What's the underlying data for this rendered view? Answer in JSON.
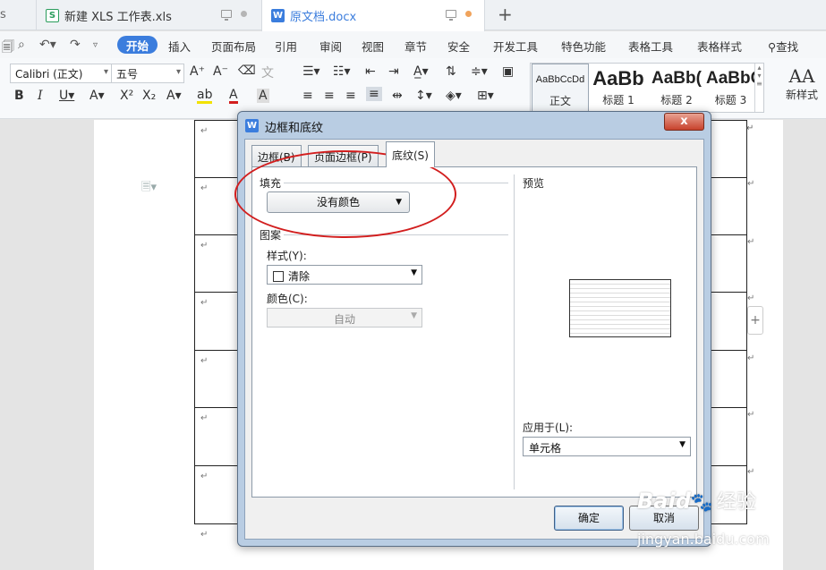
{
  "tabs": [
    {
      "label": "新建 XLS 工作表.xls",
      "icon": "S"
    },
    {
      "label": "原文档.docx",
      "icon": "W"
    }
  ],
  "new_tab_label": "+",
  "menu": {
    "start": "开始",
    "items": [
      "插入",
      "页面布局",
      "引用",
      "审阅",
      "视图",
      "章节",
      "安全",
      "开发工具",
      "特色功能",
      "表格工具",
      "表格样式"
    ],
    "search": "查找"
  },
  "ribbon": {
    "font_name": "Calibri (正文)",
    "font_size": "五号",
    "styles": [
      {
        "sample": "AaBbCcDd",
        "name": "正文"
      },
      {
        "sample": "AaBb",
        "name": "标题 1"
      },
      {
        "sample": "AaBb(",
        "name": "标题 2"
      },
      {
        "sample": "AaBbC(",
        "name": "标题 3"
      }
    ],
    "new_style_glyph": "AA",
    "new_style": "新样式"
  },
  "dialog": {
    "title": "边框和底纹",
    "close": "x",
    "tabs": [
      "边框(B)",
      "页面边框(P)",
      "底纹(S)"
    ],
    "fill_label": "填充",
    "fill_value": "没有颜色",
    "pattern_label": "图案",
    "style_label": "样式(Y):",
    "style_value": "清除",
    "color_label": "颜色(C):",
    "color_value": "自动",
    "preview_label": "预览",
    "apply_label": "应用于(L):",
    "apply_value": "单元格",
    "ok": "确定",
    "cancel": "取消"
  },
  "watermark": {
    "logo": "Baid",
    "cn": "经验",
    "site": "jingyan.baidu.com"
  },
  "colors": {
    "accent": "#3b7ddd",
    "annotation": "#d21e1e"
  }
}
